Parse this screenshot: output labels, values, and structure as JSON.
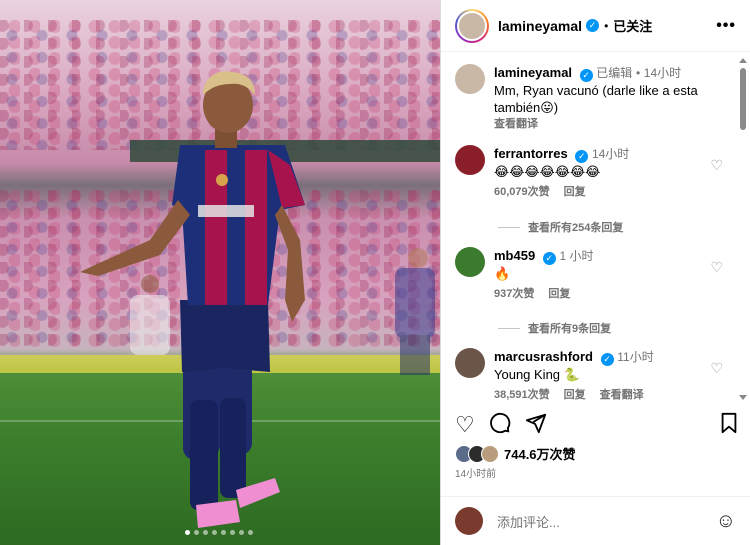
{
  "post_author": {
    "username": "lamineyamal",
    "verified_mark": "✓",
    "separator": "•",
    "follow_status": "已关注",
    "more_icon": "more-horizontal-icon"
  },
  "caption": {
    "username": "lamineyamal",
    "edited": "已编辑",
    "separator": "•",
    "time": "14小时",
    "text": "Mm, Ryan vacunó (darle like a esta también😛)",
    "translate": "查看翻译"
  },
  "comments": [
    {
      "username": "ferrantorres",
      "time": "14小时",
      "text": "😂😂😂😂😂😂😂",
      "likes": "60,079次赞",
      "reply": "回复",
      "translate": "",
      "thread": "查看所有254条回复"
    },
    {
      "username": "mb459",
      "time": "1 小时",
      "text": "🔥",
      "likes": "937次赞",
      "reply": "回复",
      "translate": "",
      "thread": "查看所有9条回复"
    },
    {
      "username": "marcusrashford",
      "time": "11小时",
      "text": "Young King 🐍",
      "likes": "38,591次赞",
      "reply": "回复",
      "translate": "查看翻译",
      "thread": ""
    }
  ],
  "actions": {
    "like_icon": "heart-icon",
    "comment_icon": "comment-icon",
    "share_icon": "send-icon",
    "save_icon": "bookmark-icon"
  },
  "likes_total": "744.6万次赞",
  "posted_time": "14小时前",
  "add_comment": {
    "placeholder": "添加评论...",
    "emoji_icon": "smiley-icon"
  },
  "carousel": {
    "total_slides": 8,
    "active_slide": 1
  },
  "colors": {
    "verified": "#0095f6",
    "secondary_text": "#737373",
    "barca_blue": "#1e2f7a",
    "barca_garnet": "#a7134d"
  }
}
